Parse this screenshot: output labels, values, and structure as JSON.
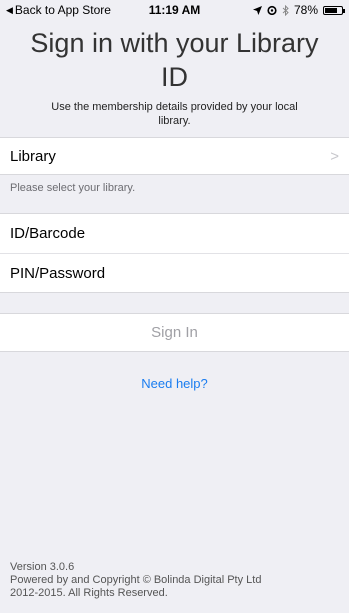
{
  "status_bar": {
    "back_label": "Back to App Store",
    "time": "11:19 AM",
    "battery": "78%",
    "battery_level": 0.78,
    "icons": [
      "location-arrow-icon",
      "alarm-icon",
      "bluetooth-icon",
      "battery-icon"
    ]
  },
  "header": {
    "title": "Sign in with your Library ID",
    "subtitle": "Use the membership details provided by your local library."
  },
  "form": {
    "library_label": "Library",
    "library_hint": "Please select your library.",
    "id_label": "ID/Barcode",
    "pin_label": "PIN/Password",
    "sign_in_label": "Sign In"
  },
  "help": {
    "label": "Need help?"
  },
  "footer": {
    "version": "Version 3.0.6",
    "copyright_line1": "Powered by and Copyright © Bolinda Digital Pty Ltd",
    "copyright_line2": "2012-2015. All Rights Reserved."
  },
  "colors": {
    "background": "#efeff4",
    "link": "#1a7df0",
    "disabled_text": "#a0a0a5"
  }
}
